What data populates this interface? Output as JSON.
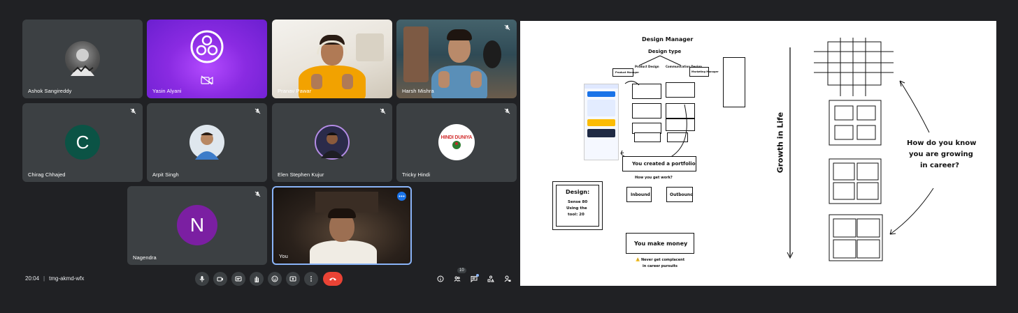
{
  "meeting": {
    "time": "20:04",
    "code": "tmg-akmd-wfx",
    "participant_count": "10"
  },
  "participants": [
    {
      "name": "Ashok Sangireddy"
    },
    {
      "name": "Yasin Alyani"
    },
    {
      "name": "Pranav Pawar"
    },
    {
      "name": "Harsh Mishra"
    },
    {
      "name": "Chirag Chhajed",
      "initial": "C"
    },
    {
      "name": "Arpit Singh"
    },
    {
      "name": "Elen Stephen Kujur"
    },
    {
      "name": "Tricky Hindi",
      "logo_text": "HINDI DUNIYA"
    },
    {
      "name": "Nagendra",
      "initial": "N"
    },
    {
      "name": "You"
    }
  ],
  "colors": {
    "background": "#202124",
    "tile": "#3c4043",
    "chirag_avatar": "#0b5345",
    "nagendra_avatar": "#7b1fa2",
    "end_call": "#ea4335",
    "active_border": "#8ab4f8",
    "more_dots": "#1a73e8"
  },
  "whiteboard": {
    "title": "Design Manager",
    "subtitle": "Design type",
    "product_design": "Product Design",
    "communication_design": "Communication Design",
    "product_manager": "Product Manager",
    "marketing_manager": "Marketing Manager",
    "portfolio": "You created a portfolio",
    "get_work": "How you get work?",
    "inbound": "Inbound",
    "outbound": "Outbound",
    "design_box_title": "Design:",
    "design_box_body1": "Sense 80",
    "design_box_body2": "Using the",
    "design_box_body3": "tool: 20",
    "make_money": "You make money",
    "complacent1": "⚠️ Never get complacent",
    "complacent2": "in career pursuits",
    "growth": "Growth in Life",
    "question1": "How do you know",
    "question2": "you are growing",
    "question3": "in career?"
  }
}
